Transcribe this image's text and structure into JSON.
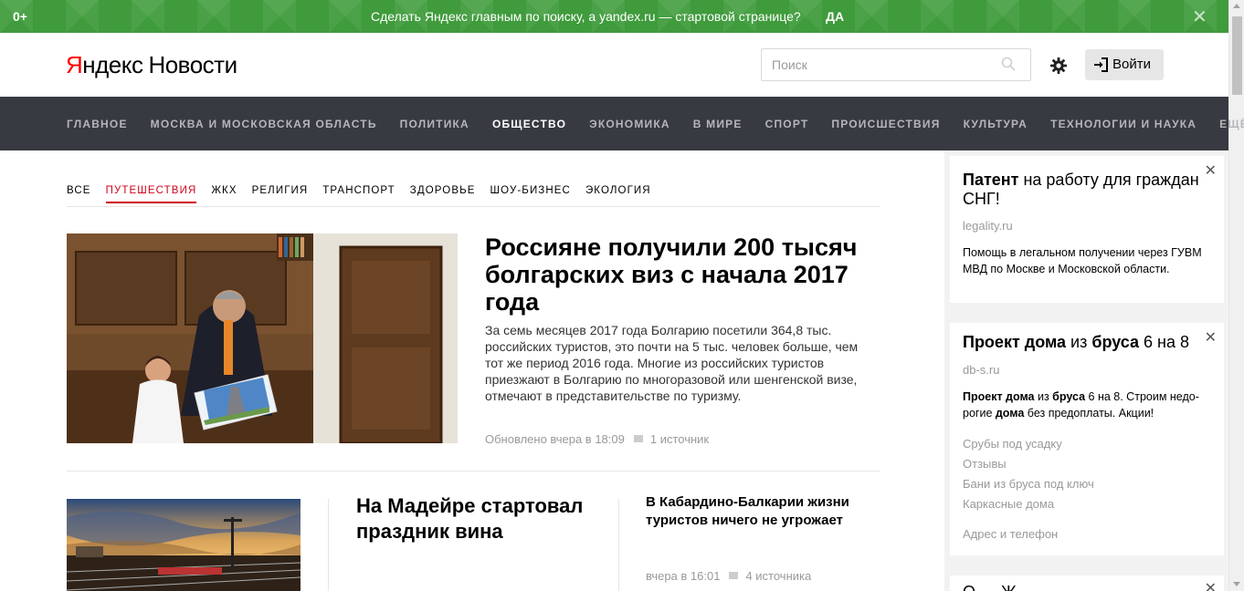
{
  "promo": {
    "age": "0+",
    "message": "Сделать Яндекс главным по поиску, а yandex.ru — стартовой странице?",
    "yes": "ДА",
    "close_icon": "close-icon"
  },
  "header": {
    "logo_brand_first": "Я",
    "logo_brand_rest": "ндекс",
    "logo_service": "Новости",
    "search_placeholder": "Поиск",
    "login_label": "Войти"
  },
  "nav": {
    "items": [
      "ГЛАВНОЕ",
      "МОСКВА И МОСКОВСКАЯ ОБЛАСТЬ",
      "ПОЛИТИКА",
      "ОБЩЕСТВО",
      "ЭКОНОМИКА",
      "В МИРЕ",
      "СПОРТ",
      "ПРОИСШЕСТВИЯ",
      "КУЛЬТУРА",
      "ТЕХНОЛОГИИ И НАУКА",
      "ЕЩЁ"
    ],
    "active": "ОБЩЕСТВО"
  },
  "subnav": {
    "items": [
      "ВСЕ",
      "ПУТЕШЕСТВИЯ",
      "ЖКХ",
      "РЕЛИГИЯ",
      "ТРАНСПОРТ",
      "ЗДОРОВЬЕ",
      "ШОУ-БИЗНЕС",
      "ЭКОЛОГИЯ"
    ],
    "active": "ПУТЕШЕСТВИЯ"
  },
  "main_story": {
    "title": "Россияне получили 200 тысяч болгарских виз с начала 2017 года",
    "text": "За семь месяцев 2017 года Болгарию посетили 364,8 тыс. российских туристов, это почти на 5 тыс. человек больше, чем тот же период 2016 года. Многие из российских туристов приезжают в Болгарию по многоразовой или шенгенской визе, отмечают в представительстве по туризму.",
    "updated": "Обновлено вчера в 18:09",
    "sources": "1 источник"
  },
  "story2": {
    "title": "На Мадейре стартовал праздник вина"
  },
  "story3": {
    "title": "В Кабардино-Балкарии жизни туристов ничего не угрожает",
    "time": "вчера в 16:01",
    "sources": "4 источника"
  },
  "ads": {
    "ad1": {
      "title_bold": "Патент",
      "title_rest": " на работу для граждан СНГ!",
      "domain": "legality.ru",
      "desc": "Помощь в легальном получении через ГУВМ МВД по Москве и Московской области."
    },
    "ad2": {
      "title_b1": "Проект дома",
      "title_t1": " из ",
      "title_b2": "бруса",
      "title_t2": " 6 на 8",
      "domain": "db-s.ru",
      "desc_b1": "Проект дома",
      "desc_t1": " из ",
      "desc_b2": "бруса",
      "desc_t2": " 6 на 8. Строим недо-рогие ",
      "desc_b3": "дома",
      "desc_t3": " без предоплаты. Акции!",
      "links": [
        "Срубы под усадку",
        "Отзывы",
        "Бани из бруса под ключ",
        "Каркасные дома"
      ],
      "contact": "Адрес и телефон"
    },
    "ad3": {
      "title_partial": "О … Ж"
    }
  },
  "colors": {
    "promo_green": "#3f9b3c",
    "nav_bg": "#373a41",
    "accent_red": "#d0021b",
    "logo_red": "#ff0000"
  }
}
